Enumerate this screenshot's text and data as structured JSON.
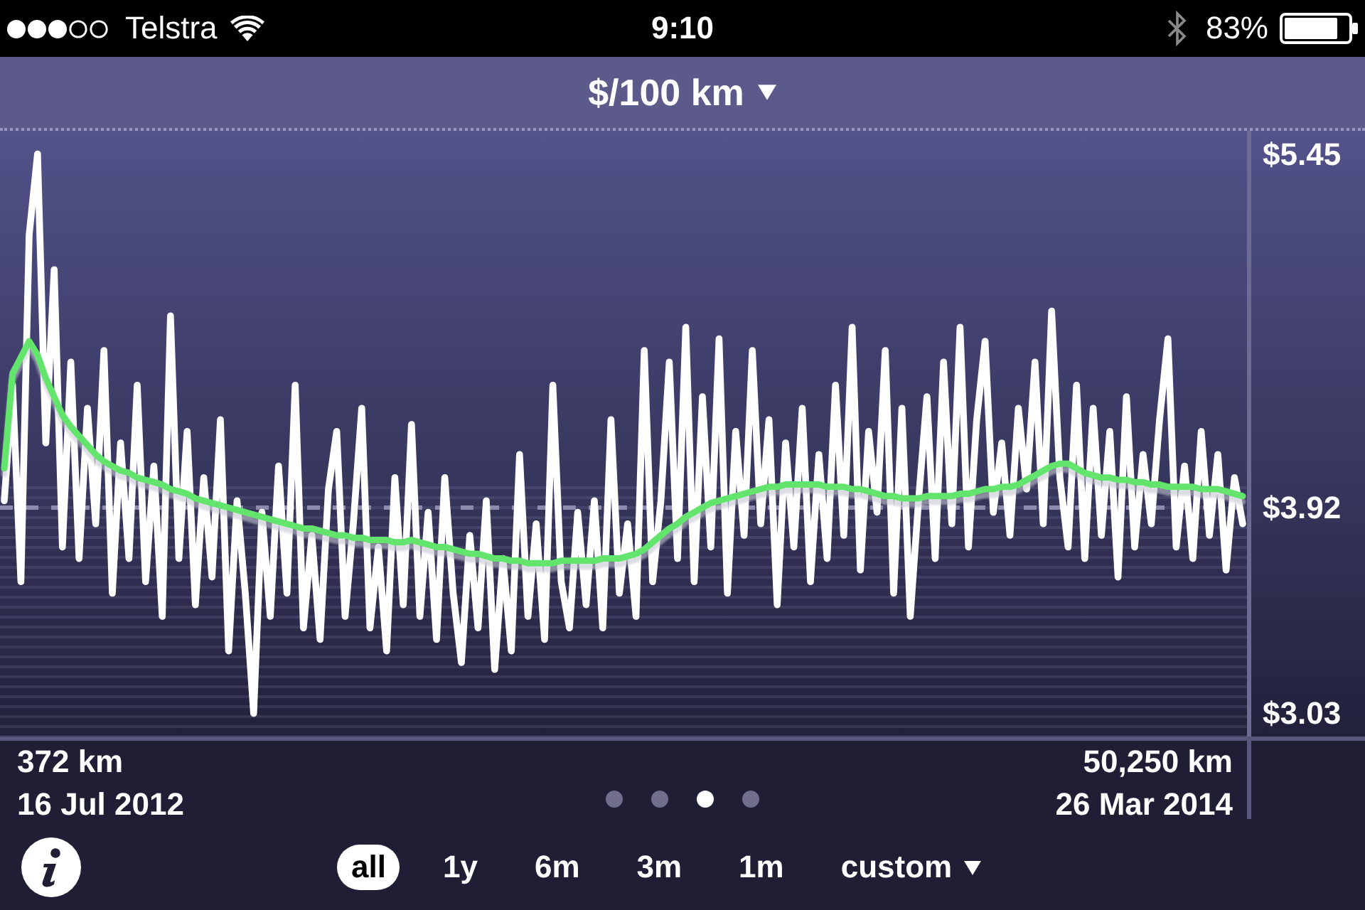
{
  "status_bar": {
    "carrier": "Telstra",
    "time": "9:10",
    "battery": "83%"
  },
  "header": {
    "title": "$/100 km"
  },
  "chart": {
    "chart_data": {
      "type": "line",
      "ylim": [
        2.93,
        5.55
      ],
      "yticks": [
        {
          "value": 5.45,
          "label": "$5.45"
        },
        {
          "value": 3.92,
          "label": "$3.92"
        },
        {
          "value": 3.03,
          "label": "$3.03"
        }
      ],
      "ref_lines": [
        {
          "axis": "y",
          "value": 3.92
        }
      ],
      "series": [
        {
          "color": "#ffffff",
          "values": [
            3.95,
            4.45,
            3.6,
            5.1,
            5.45,
            4.2,
            4.95,
            3.75,
            4.55,
            3.7,
            4.35,
            3.85,
            4.6,
            3.55,
            4.2,
            3.7,
            4.45,
            3.6,
            4.1,
            3.45,
            4.75,
            3.7,
            4.25,
            3.5,
            4.05,
            3.62,
            4.3,
            3.3,
            3.95,
            3.55,
            3.03,
            3.9,
            3.45,
            4.1,
            3.55,
            4.45,
            3.4,
            3.8,
            3.35,
            4.0,
            4.25,
            3.45,
            3.85,
            4.35,
            3.4,
            3.75,
            3.3,
            4.05,
            3.5,
            4.28,
            3.45,
            3.9,
            3.35,
            4.05,
            3.55,
            3.25,
            3.8,
            3.4,
            3.95,
            3.22,
            3.7,
            3.3,
            4.15,
            3.45,
            3.85,
            3.35,
            4.45,
            3.6,
            3.4,
            3.9,
            3.5,
            3.95,
            3.4,
            4.3,
            3.55,
            3.85,
            3.45,
            4.6,
            3.6,
            3.95,
            4.55,
            3.7,
            4.7,
            3.6,
            4.4,
            3.75,
            4.65,
            3.55,
            4.25,
            3.8,
            4.6,
            3.85,
            4.3,
            3.5,
            4.2,
            3.75,
            4.35,
            3.6,
            4.15,
            3.7,
            4.45,
            3.8,
            4.7,
            3.65,
            4.25,
            3.9,
            4.6,
            3.55,
            4.35,
            3.45,
            3.95,
            4.4,
            3.7,
            4.55,
            3.85,
            4.7,
            3.75,
            4.3,
            4.64,
            3.9,
            4.2,
            3.8,
            4.35,
            4.0,
            4.55,
            3.85,
            4.77,
            4.05,
            3.75,
            4.45,
            3.7,
            4.35,
            3.8,
            4.25,
            3.62,
            4.4,
            3.75,
            4.15,
            3.85,
            4.3,
            4.65,
            3.75,
            4.1,
            3.7,
            4.25,
            3.8,
            4.15,
            3.65,
            4.05,
            3.85
          ]
        },
        {
          "color": "#62e46d",
          "values": [
            4.09,
            4.5,
            4.57,
            4.64,
            4.58,
            4.48,
            4.4,
            4.32,
            4.27,
            4.23,
            4.19,
            4.15,
            4.12,
            4.1,
            4.08,
            4.07,
            4.05,
            4.04,
            4.03,
            4.02,
            4.0,
            3.99,
            3.98,
            3.96,
            3.95,
            3.94,
            3.93,
            3.92,
            3.91,
            3.9,
            3.89,
            3.88,
            3.87,
            3.86,
            3.85,
            3.84,
            3.83,
            3.83,
            3.82,
            3.81,
            3.8,
            3.8,
            3.79,
            3.79,
            3.78,
            3.78,
            3.78,
            3.77,
            3.77,
            3.78,
            3.77,
            3.76,
            3.75,
            3.75,
            3.74,
            3.73,
            3.72,
            3.72,
            3.71,
            3.7,
            3.7,
            3.69,
            3.69,
            3.68,
            3.68,
            3.68,
            3.68,
            3.69,
            3.69,
            3.69,
            3.69,
            3.69,
            3.7,
            3.7,
            3.7,
            3.71,
            3.72,
            3.74,
            3.77,
            3.8,
            3.83,
            3.85,
            3.88,
            3.9,
            3.92,
            3.94,
            3.95,
            3.96,
            3.97,
            3.98,
            3.99,
            4.0,
            4.01,
            4.01,
            4.02,
            4.02,
            4.02,
            4.02,
            4.02,
            4.01,
            4.01,
            4.01,
            4.0,
            4.0,
            3.99,
            3.98,
            3.97,
            3.97,
            3.96,
            3.96,
            3.96,
            3.97,
            3.97,
            3.97,
            3.97,
            3.98,
            3.98,
            3.99,
            4.0,
            4.0,
            4.01,
            4.01,
            4.02,
            4.04,
            4.06,
            4.08,
            4.1,
            4.11,
            4.11,
            4.09,
            4.07,
            4.06,
            4.05,
            4.05,
            4.04,
            4.04,
            4.03,
            4.03,
            4.02,
            4.02,
            4.01,
            4.01,
            4.01,
            4.01,
            4.0,
            4.0,
            4.0,
            3.99,
            3.98,
            3.97
          ]
        }
      ]
    }
  },
  "range": {
    "start_distance": "372 km",
    "start_date": "16 Jul 2012",
    "end_distance": "50,250 km",
    "end_date": "26 Mar 2014"
  },
  "pages": [
    {
      "selected": false
    },
    {
      "selected": false
    },
    {
      "selected": true
    },
    {
      "selected": false
    }
  ],
  "periods": [
    {
      "label": "all",
      "kind": "plain",
      "selected": true
    },
    {
      "label": "1y",
      "kind": "plain",
      "selected": false
    },
    {
      "label": "6m",
      "kind": "plain",
      "selected": false
    },
    {
      "label": "3m",
      "kind": "plain",
      "selected": false
    },
    {
      "label": "1m",
      "kind": "plain",
      "selected": false
    },
    {
      "label": "custom",
      "kind": "menu",
      "selected": false
    }
  ]
}
